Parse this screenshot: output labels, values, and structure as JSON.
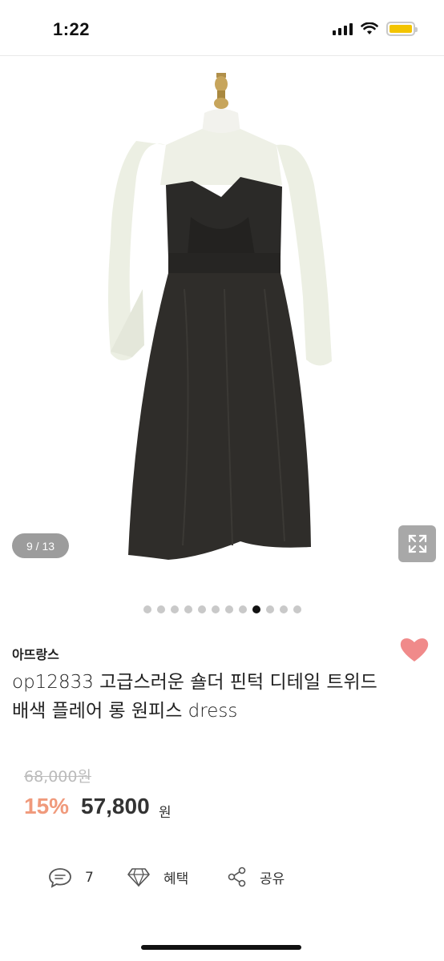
{
  "status_bar": {
    "time": "1:22",
    "battery_color": "#f3c400"
  },
  "image_viewer": {
    "counter": "9 / 13",
    "current_index": 9,
    "total_dots": 12,
    "active_dot": 8
  },
  "product": {
    "brand": "아뜨랑스",
    "title_line1": "op12833 고급스러운 숄더 핀턱 디테일 트위드",
    "title_line2": "배색 플레어 롱 원피스 dress",
    "original_price": "68,000원",
    "discount": "15%",
    "price": "57,800",
    "price_unit": "원",
    "wishlist_color": "#f08a8a"
  },
  "actions": {
    "comments_count": "7",
    "benefit_label": "혜택",
    "share_label": "공유"
  },
  "icons": [
    "comment-icon",
    "diamond-icon",
    "share-icon",
    "heart-icon",
    "expand-icon",
    "wifi-icon",
    "signal-icon",
    "battery-icon"
  ]
}
